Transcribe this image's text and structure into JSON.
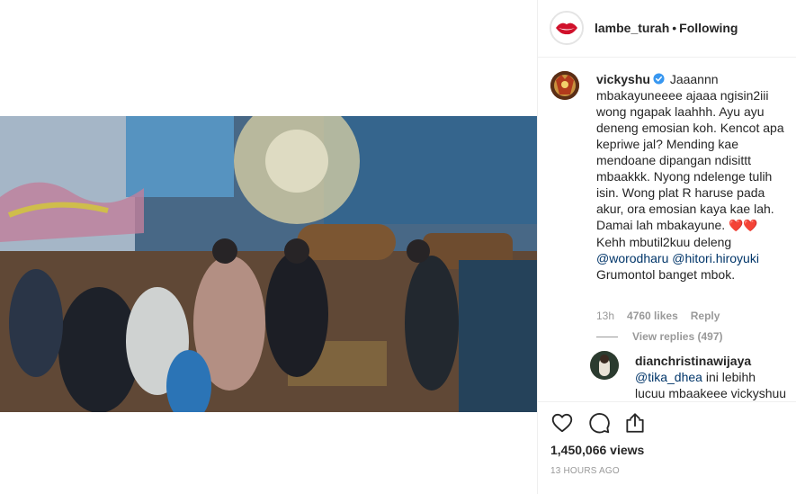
{
  "post": {
    "username": "lambe_turah",
    "separator": "•",
    "follow_status": "Following"
  },
  "comment": {
    "username": "vickyshu",
    "verified_icon": "verified-badge-icon",
    "text_1": "Jaaannn mbakayuneeee ajaaa ngisin2iii wong ngapak laahhh. Ayu ayu deneng emosian koh. Kencot apa kepriwe jal? Mending kae mendoane dipangan ndisittt mbaakkk. Nyong ndelenge tulih isin. Wong plat R haruse pada akur, ora emosian kaya kae lah. Damai lah mbakayune.",
    "hearts": "❤️❤️",
    "text_2": "Kehh mbutil2kuu deleng",
    "mention_1": "@worodharu",
    "mention_2": "@hitori.hiroyuki",
    "text_3": "Grumontol banget mbok.",
    "time": "13h",
    "likes": "4760 likes",
    "reply_label": "Reply",
    "view_replies": "View replies (497)"
  },
  "reply": {
    "username": "dianchristinawijaya",
    "mention": "@tika_dhea",
    "text": "ini lebihh lucuu mbaakeee vickyshuu"
  },
  "actions": {
    "like_icon": "heart-icon",
    "comment_icon": "comment-icon",
    "share_icon": "share-icon"
  },
  "stats": {
    "views": "1,450,066 views",
    "timestamp": "13 HOURS AGO"
  },
  "colors": {
    "link": "#003569",
    "muted": "#999999",
    "verified": "#3897f0",
    "border": "#efefef"
  }
}
